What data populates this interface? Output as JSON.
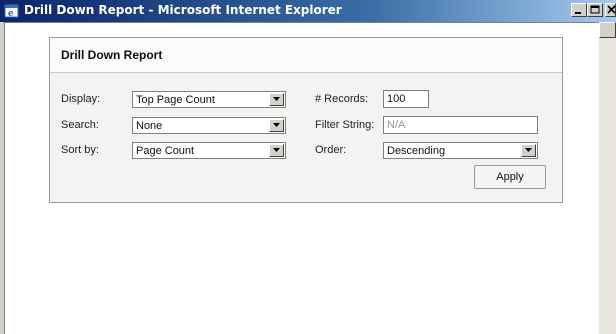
{
  "window": {
    "title": "Drill Down Report - Microsoft Internet Explorer",
    "icon": "ie-icon",
    "title_bar_colors": [
      "#0a246a",
      "#a6caf0"
    ]
  },
  "panel": {
    "title": "Drill Down Report"
  },
  "form": {
    "display": {
      "label": "Display:",
      "value": "Top Page Count"
    },
    "search": {
      "label": "Search:",
      "value": "None"
    },
    "sort_by": {
      "label": "Sort by:",
      "value": "Page Count"
    },
    "records": {
      "label": "# Records:",
      "value": "100"
    },
    "filter_string": {
      "label": "Filter String:",
      "value": "N/A"
    },
    "order": {
      "label": "Order:",
      "value": "Descending"
    },
    "apply_label": "Apply"
  }
}
